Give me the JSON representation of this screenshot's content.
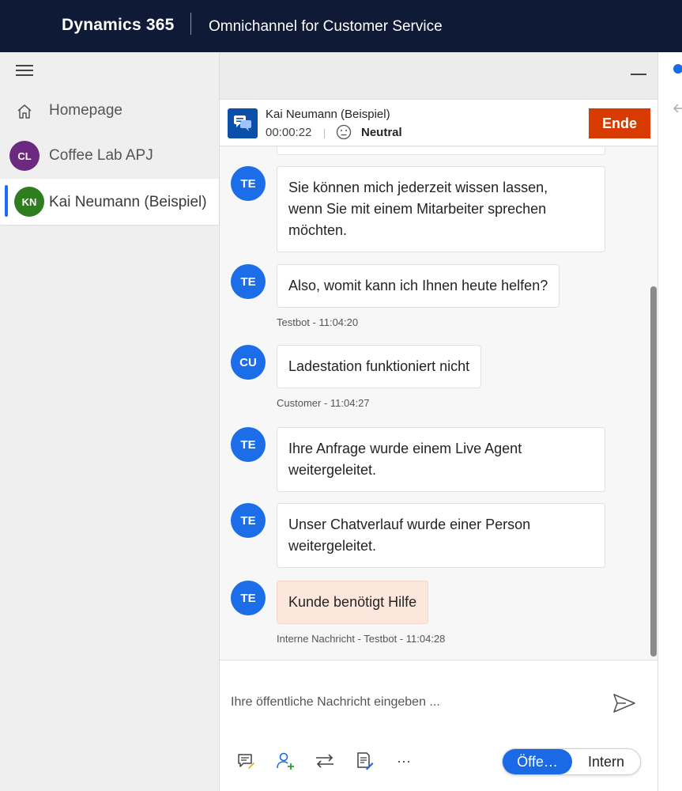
{
  "topbar": {
    "brand": "Dynamics 365",
    "app_name": "Omnichannel for Customer Service"
  },
  "sidebar": {
    "items": [
      {
        "label": "Homepage",
        "icon": "home-icon"
      },
      {
        "label": "Coffee Lab APJ",
        "initials": "CL",
        "color": "#6b2a7f"
      },
      {
        "label": "Kai Neumann (Beispiel)",
        "initials": "KN",
        "color": "#2e7d1f",
        "active": true
      }
    ]
  },
  "conversation": {
    "customer_name": "Kai Neumann (Beispiel)",
    "timer": "00:00:22",
    "sentiment": "Neutral",
    "end_button": "Ende"
  },
  "messages": [
    {
      "initials": "TE",
      "lines": [
        "Sie können mich jederzeit wissen lassen,",
        "wenn Sie mit einem Mitarbeiter sprechen",
        "möchten."
      ],
      "meta": ""
    },
    {
      "initials": "TE",
      "lines": [
        "Also, womit kann ich Ihnen heute helfen?"
      ],
      "meta": "Testbot - 11:04:20"
    },
    {
      "initials": "CU",
      "lines": [
        "Ladestation funktioniert nicht"
      ],
      "meta": "Customer - 11:04:27"
    },
    {
      "initials": "TE",
      "lines": [
        "Ihre Anfrage wurde einem Live Agent",
        "weitergeleitet."
      ],
      "meta": ""
    },
    {
      "initials": "TE",
      "lines": [
        "Unser Chatverlauf wurde einer Person",
        "weitergeleitet."
      ],
      "meta": ""
    },
    {
      "initials": "TE",
      "lines": [
        "Kunde benötigt Hilfe"
      ],
      "meta": "Interne Nachricht - Testbot - 11:04:28",
      "internal": true
    }
  ],
  "composer": {
    "placeholder": "Ihre öffentliche Nachricht eingeben ...",
    "mode_public": "Öffe…",
    "mode_internal": "Intern",
    "more": "···"
  },
  "colors": {
    "topbar": "#0f1a36",
    "accent": "#1a6ae6",
    "end_button": "#d83b01",
    "internal_bubble": "#fde7dc"
  }
}
